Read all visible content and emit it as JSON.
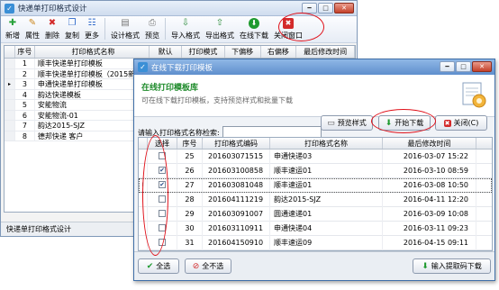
{
  "main_window": {
    "title": "快递单打印格式设计",
    "controls": [
      "━",
      "□",
      "✕"
    ],
    "toolbar": [
      {
        "label": "新增",
        "icon": "plus-icon",
        "glyph": "✚",
        "color": "#27a13a"
      },
      {
        "label": "属性",
        "icon": "edit-icon",
        "glyph": "✎",
        "color": "#c9851b"
      },
      {
        "label": "删除",
        "icon": "delete-icon",
        "glyph": "✖",
        "color": "#d32a2a"
      },
      {
        "label": "复制",
        "icon": "copy-icon",
        "glyph": "❐",
        "color": "#2a66c9"
      },
      {
        "label": "更多",
        "icon": "more-icon",
        "glyph": "☷",
        "color": "#2a66c9"
      },
      {
        "label": "设计格式",
        "icon": "design-icon",
        "glyph": "▤",
        "color": "#777"
      },
      {
        "label": "预览",
        "icon": "preview-icon",
        "glyph": "⎙",
        "color": "#777"
      },
      {
        "label": "导入格式",
        "icon": "import-icon",
        "glyph": "⇩",
        "color": "#2a8a3a"
      },
      {
        "label": "导出格式",
        "icon": "export-icon",
        "glyph": "⇧",
        "color": "#2a8a3a"
      },
      {
        "label": "在线下载",
        "icon": "online-download-icon",
        "glyph": "⬇",
        "color": "#1f9a2f"
      },
      {
        "label": "关闭窗口",
        "icon": "close-window-icon",
        "glyph": "✖",
        "color": "#d32a2a"
      }
    ],
    "table": {
      "headers": [
        "序号",
        "打印格式名称",
        "默认",
        "打印模式",
        "下偏移",
        "右偏移",
        "最后修改时间"
      ],
      "rows": [
        {
          "no": "1",
          "name": "顺丰快递单打印模板",
          "marker": ""
        },
        {
          "no": "2",
          "name": "顺丰快递单打印模板（2015新",
          "marker": ""
        },
        {
          "no": "3",
          "name": "申通快递单打印模板",
          "marker": "▸"
        },
        {
          "no": "4",
          "name": "韵达快递模板",
          "marker": ""
        },
        {
          "no": "5",
          "name": "安能物流",
          "marker": ""
        },
        {
          "no": "6",
          "name": "安能物流-01",
          "marker": ""
        },
        {
          "no": "7",
          "name": "韵达2015-SJZ",
          "marker": ""
        },
        {
          "no": "8",
          "name": "德邦快递 客户",
          "marker": ""
        }
      ]
    },
    "status": "快递单打印格式设计"
  },
  "dialog": {
    "title": "在线下载打印模板",
    "heading": "在线打印模板库",
    "subheading": "可在线下载打印模板，支持预览样式和批量下载",
    "search_label": "请输入打印格式名称检索:",
    "search_value": "",
    "buttons": {
      "preview": "预览样式",
      "start_download": "开始下载",
      "close": "关闭(C)",
      "select_all": "全选",
      "select_none": "全不选",
      "import_code": "输入提取码下载"
    },
    "table": {
      "headers": [
        "选择",
        "序号",
        "打印格式编码",
        "打印格式名称",
        "最后修改时间"
      ],
      "rows": [
        {
          "checked": false,
          "no": "25",
          "code": "201603071515",
          "name": "申通快递03",
          "time": "2016-03-07 15:22",
          "marker": ""
        },
        {
          "checked": true,
          "no": "26",
          "code": "201603100858",
          "name": "顺丰速运01",
          "time": "2016-03-10 08:59",
          "marker": ""
        },
        {
          "checked": true,
          "no": "27",
          "code": "201603081048",
          "name": "顺丰速运01",
          "time": "2016-03-08 10:50",
          "marker": "I"
        },
        {
          "checked": false,
          "no": "28",
          "code": "201604111219",
          "name": "韵达2015-SJZ",
          "time": "2016-04-11 12:20",
          "marker": ""
        },
        {
          "checked": false,
          "no": "29",
          "code": "201603091007",
          "name": "圆通速递01",
          "time": "2016-03-09 10:08",
          "marker": ""
        },
        {
          "checked": false,
          "no": "30",
          "code": "201603110911",
          "name": "申通快递04",
          "time": "2016-03-11 09:23",
          "marker": ""
        },
        {
          "checked": false,
          "no": "31",
          "code": "201604150910",
          "name": "顺丰速运09",
          "time": "2016-04-15 09:11",
          "marker": ""
        },
        {
          "checked": false,
          "no": "32",
          "code": "201604121130",
          "name": "韵达制付",
          "time": "2016-04-12 11:30",
          "marker": ""
        }
      ]
    }
  },
  "annotation_color": "#e0111a"
}
